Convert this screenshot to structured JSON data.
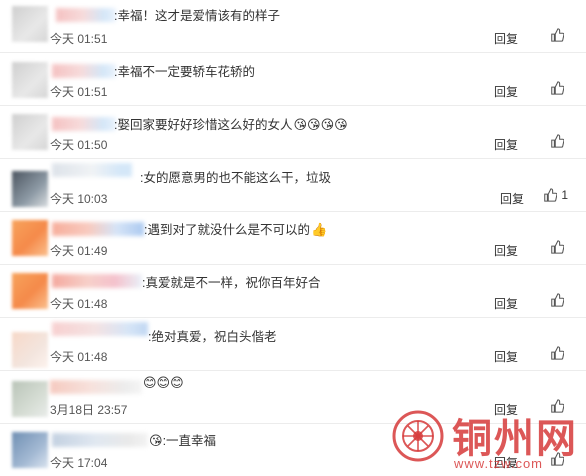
{
  "comments": [
    {
      "text": ":幸福！这才是爱情该有的样子",
      "emoji": "",
      "time": "今天 01:51",
      "reply": "回复",
      "likes": ""
    },
    {
      "text": ":幸福不一定要轿车花轿的",
      "emoji": "",
      "time": "今天 01:51",
      "reply": "回复",
      "likes": ""
    },
    {
      "text": ":娶回家要好好珍惜这么好的女人",
      "emoji": "😘😘😘😘",
      "time": "今天 01:50",
      "reply": "回复",
      "likes": ""
    },
    {
      "text": ":女的愿意男的也不能这么干，垃圾",
      "emoji": "",
      "time": "今天 10:03",
      "reply": "回复",
      "likes": "1"
    },
    {
      "text": ":遇到对了就没什么是不可以的",
      "emoji": "👍",
      "time": "今天 01:49",
      "reply": "回复",
      "likes": ""
    },
    {
      "text": ":真爱就是不一样，祝你百年好合",
      "emoji": "",
      "time": "今天 01:48",
      "reply": "回复",
      "likes": ""
    },
    {
      "text": ":绝对真爱，祝白头偕老",
      "emoji": "",
      "time": "今天 01:48",
      "reply": "回复",
      "likes": ""
    },
    {
      "text": "",
      "emoji": "😊😊😊",
      "time": "3月18日 23:57",
      "reply": "回复",
      "likes": ""
    },
    {
      "text": ":一直幸福",
      "emoji": "😘",
      "time": "今天 17:04",
      "reply": "回复",
      "likes": ""
    }
  ],
  "watermark": {
    "title": "铜州网",
    "url": "www.tzw.com"
  },
  "colors": {
    "watermark": "#d63a3a",
    "divider": "#ececec"
  }
}
